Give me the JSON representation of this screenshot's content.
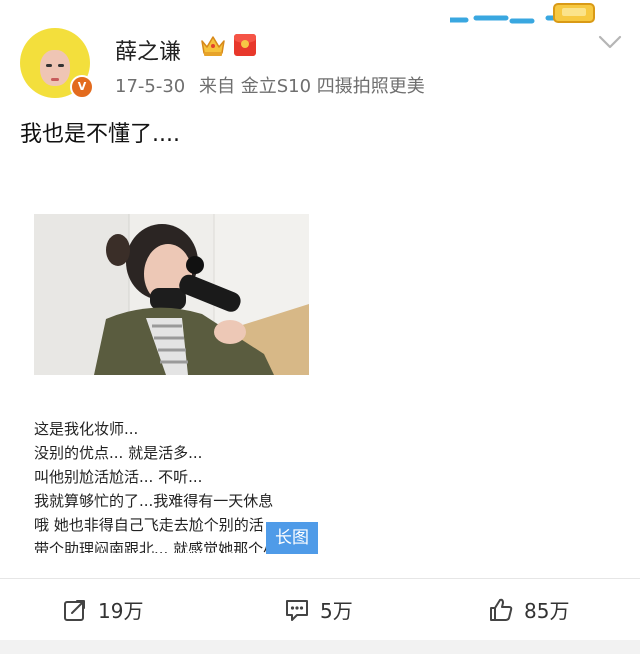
{
  "post": {
    "author": "薛之谦",
    "verified_badge": "V",
    "date": "17-5-30",
    "source": "来自 金立S10 四摄拍照更美",
    "text": "我也是不懂了....",
    "long_image": {
      "lines": [
        "这是我化妆师...",
        "没别的优点... 就是活多...",
        "叫他别尬活尬活... 不听...",
        "我就算够忙的了...我难得有一天休息",
        "哦 她也非得自己飞走去尬个别的活",
        "带个助理闷南跟北... 就感觉她那个小"
      ],
      "badge": "长图"
    }
  },
  "actions": {
    "repost": {
      "icon": "share-icon",
      "count": "19万"
    },
    "comment": {
      "icon": "comment-icon",
      "count": "5万"
    },
    "like": {
      "icon": "thumbs-up-icon",
      "count": "85万"
    }
  },
  "colors": {
    "accent": "#4f9be8",
    "vip": "#e36b1e",
    "red_packet": "#e8382b"
  }
}
